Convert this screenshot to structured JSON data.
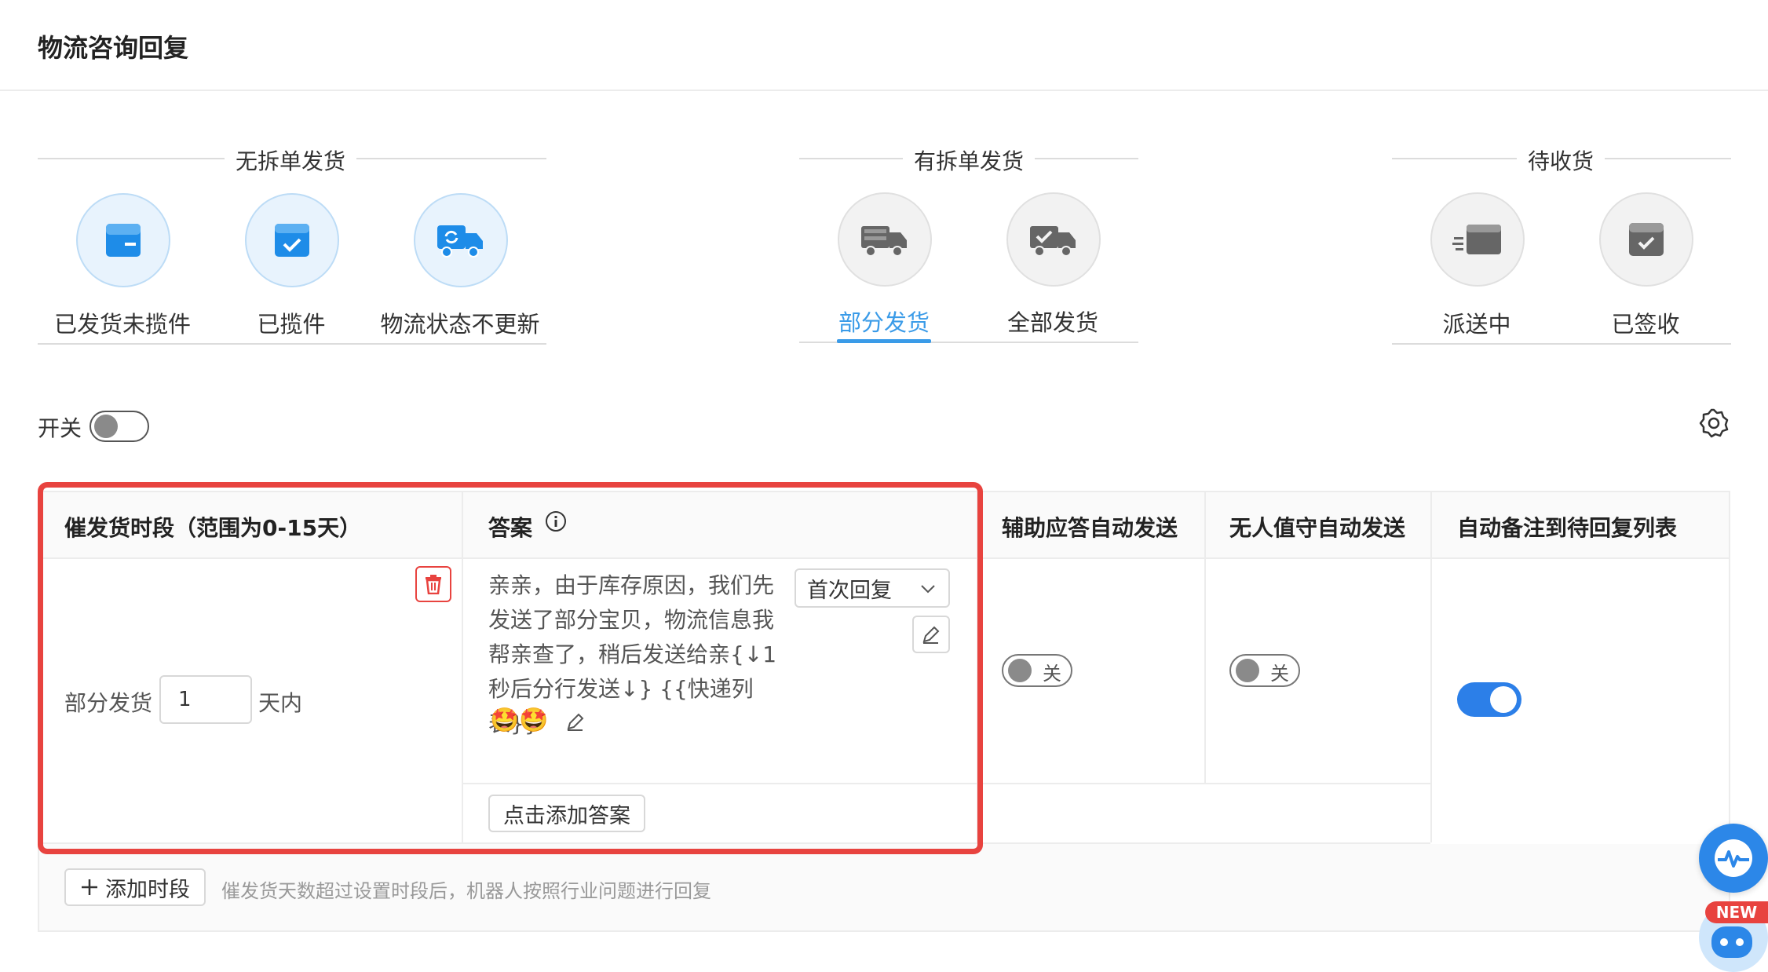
{
  "page": {
    "title": "物流咨询回复"
  },
  "groups": [
    {
      "title": "无拆单发货",
      "items": [
        {
          "label": "已发货未揽件",
          "icon": "box-card-icon"
        },
        {
          "label": "已揽件",
          "icon": "box-check-icon"
        },
        {
          "label": "物流状态不更新",
          "icon": "truck-refresh-icon"
        }
      ]
    },
    {
      "title": "有拆单发货",
      "items": [
        {
          "label": "部分发货",
          "icon": "truck-boxes-icon",
          "active": true
        },
        {
          "label": "全部发货",
          "icon": "truck-check-icon"
        }
      ]
    },
    {
      "title": "待收货",
      "items": [
        {
          "label": "派送中",
          "icon": "fast-box-icon"
        },
        {
          "label": "已签收",
          "icon": "box-signed-icon"
        }
      ]
    }
  ],
  "master_switch": {
    "label": "开关",
    "on": false
  },
  "table": {
    "headers": {
      "period": "催发货时段（范围为0-15天）",
      "answer": "答案",
      "assist": "辅助应答自动发送",
      "unattended": "无人值守自动发送",
      "auto_note": "自动备注到待回复列表"
    },
    "row": {
      "period_prefix": "部分发货",
      "period_value": "1",
      "period_suffix": "天内",
      "answer_lines": [
        "亲亲，由于库存原因，我们先",
        "发送了部分宝贝，物流信息我",
        "帮亲查了，稍后发送给亲{↓1",
        "秒后分行发送↓} {{快递列表}}"
      ],
      "answer_emoji": "🤩🤩",
      "reply_type": "首次回复",
      "add_answer_label": "点击添加答案",
      "assist_switch": {
        "on": false,
        "label": "关"
      },
      "unattended_switch": {
        "on": false,
        "label": "关"
      },
      "auto_note_switch": {
        "on": true
      }
    }
  },
  "footer": {
    "add_period_label": "添加时段",
    "hint": "催发货天数超过设置时段后，机器人按照行业问题进行回复"
  },
  "float_badge": "NEW",
  "colors": {
    "accent": "#3a9be8",
    "highlight_border": "#e8433f",
    "switch_on": "#2c7fe8"
  }
}
